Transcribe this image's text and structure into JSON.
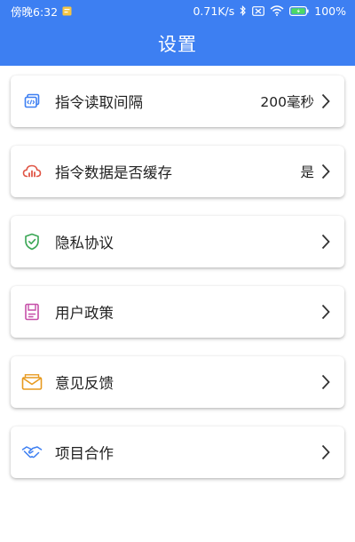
{
  "status_bar": {
    "time": "傍晚6:32",
    "network_speed": "0.71K/s",
    "battery": "100%",
    "icons": [
      "notification-icon",
      "bluetooth-icon",
      "sim-icon",
      "wifi-icon",
      "battery-icon"
    ]
  },
  "header": {
    "title": "设置",
    "background_color": "#3d7ff2"
  },
  "settings": {
    "items": [
      {
        "label": "指令读取间隔",
        "value": "200毫秒",
        "icon": "code-window-icon",
        "icon_color": "#3d7ff2"
      },
      {
        "label": "指令数据是否缓存",
        "value": "是",
        "icon": "cloud-chart-icon",
        "icon_color": "#e05545"
      },
      {
        "label": "隐私协议",
        "value": "",
        "icon": "shield-check-icon",
        "icon_color": "#3aa655"
      },
      {
        "label": "用户政策",
        "value": "",
        "icon": "document-icon",
        "icon_color": "#c64fa8"
      },
      {
        "label": "意见反馈",
        "value": "",
        "icon": "envelope-icon",
        "icon_color": "#e79a1f"
      },
      {
        "label": "项目合作",
        "value": "",
        "icon": "handshake-icon",
        "icon_color": "#3d7ff2"
      }
    ]
  }
}
